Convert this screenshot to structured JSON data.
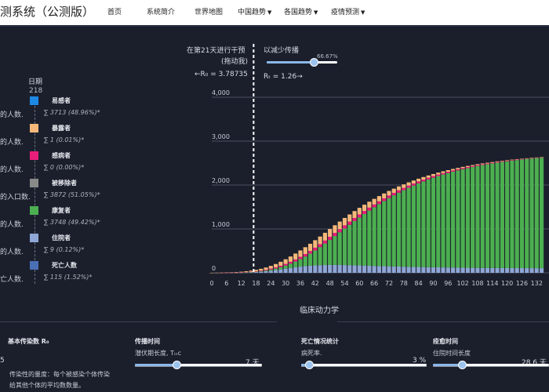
{
  "header": {
    "title": "测系统（公测版）",
    "nav": [
      {
        "label": "首页",
        "dropdown": false
      },
      {
        "label": "系统简介",
        "dropdown": false
      },
      {
        "label": "世界地图",
        "dropdown": false
      },
      {
        "label": "中国趋势",
        "dropdown": true
      },
      {
        "label": "各国趋势",
        "dropdown": true
      },
      {
        "label": "疫情预测",
        "dropdown": true
      }
    ]
  },
  "legend": {
    "date_label": "日期",
    "date_value": "218",
    "items": [
      {
        "left_text": "的人数.",
        "name": "易感者",
        "sum": "∑ 3713 (48.96%)*",
        "color": "#1e88e5"
      },
      {
        "left_text": "的人数.",
        "name": "暴露者",
        "sum": "∑ 1 (0.01%)*",
        "color": "#f5b87a"
      },
      {
        "left_text": "的人数.",
        "name": "感病者",
        "sum": "∑ 0 (0.00%)*",
        "color": "#e91e7a"
      },
      {
        "left_text": "的入口数.",
        "name": "被移除者",
        "sum": "∑ 3872 (51.05%)*",
        "color": "#8a8a8a"
      },
      {
        "left_text": "的人数.",
        "name": "康复者",
        "sum": "∑ 3748 (49.42%)*",
        "color": "#4caf50"
      },
      {
        "left_text": "的人数.",
        "name": "住院者",
        "sum": "∑ 9 (0.12%)*",
        "color": "#8fa6d6"
      },
      {
        "left_text": "亡人数.",
        "name": "死亡人数",
        "sum": "∑ 115 (1.52%)*",
        "color": "#4a6fb5"
      }
    ]
  },
  "intervention": {
    "line1": "在第21天进行干预",
    "line2": "(拖动我)",
    "r0_text": "←R₀ = 3.78735",
    "reduce_label": "以减少传播",
    "reduce_pct": "66.67%",
    "reduce_fraction": 0.6667,
    "rt_text": "Rₜ = 1.26→"
  },
  "chart_data": {
    "type": "bar",
    "stacked": true,
    "x_ticks": [
      "0",
      "6",
      "12",
      "18",
      "24",
      "30",
      "36",
      "42",
      "48",
      "54",
      "60",
      "66",
      "72",
      "78",
      "84",
      "90",
      "96",
      "102",
      "108",
      "114",
      "120",
      "126",
      "132"
    ],
    "y_ticks": [
      "0",
      "1,000",
      "2,000",
      "3,000",
      "4,000"
    ],
    "ylim": [
      0,
      4000
    ],
    "x_start": 0,
    "x_step": 2,
    "intervention_day": 17,
    "series": [
      {
        "name": "住院者",
        "color": "#8fa6d6",
        "values": [
          0,
          0,
          0,
          1,
          2,
          3,
          5,
          8,
          12,
          18,
          25,
          35,
          48,
          62,
          78,
          95,
          112,
          128,
          142,
          154,
          163,
          170,
          175,
          178,
          180,
          180,
          179,
          177,
          175,
          172,
          169,
          165,
          162,
          158,
          155,
          152,
          149,
          146,
          143,
          140,
          138,
          135,
          133,
          131,
          129,
          127,
          125,
          123,
          121,
          120,
          118,
          117,
          115,
          114,
          113,
          112,
          111,
          110,
          110,
          109,
          108,
          108,
          107,
          107,
          106,
          106,
          105,
          105
        ]
      },
      {
        "name": "康复者",
        "color": "#4caf50",
        "values": [
          0,
          0,
          0,
          0,
          0,
          1,
          2,
          3,
          5,
          8,
          12,
          18,
          26,
          37,
          52,
          72,
          98,
          130,
          170,
          218,
          275,
          340,
          412,
          490,
          572,
          658,
          745,
          833,
          920,
          1007,
          1092,
          1175,
          1256,
          1335,
          1411,
          1484,
          1554,
          1620,
          1683,
          1743,
          1800,
          1854,
          1905,
          1953,
          1998,
          2040,
          2080,
          2117,
          2152,
          2185,
          2216,
          2245,
          2272,
          2297,
          2321,
          2343,
          2363,
          2382,
          2400,
          2417,
          2433,
          2448,
          2462,
          2475,
          2487,
          2498,
          2508,
          2517
        ]
      },
      {
        "name": "感病者",
        "color": "#e91e7a",
        "values": [
          0,
          0,
          1,
          1,
          2,
          3,
          4,
          6,
          8,
          11,
          14,
          18,
          22,
          27,
          32,
          37,
          42,
          47,
          52,
          56,
          60,
          63,
          66,
          68,
          70,
          71,
          72,
          72,
          72,
          71,
          70,
          69,
          67,
          65,
          63,
          61,
          59,
          56,
          54,
          51,
          49,
          46,
          44,
          41,
          39,
          37,
          35,
          33,
          31,
          29,
          27,
          25,
          24,
          22,
          21,
          19,
          18,
          17,
          16,
          15,
          14,
          13,
          12,
          11,
          10,
          10,
          9,
          9
        ]
      },
      {
        "name": "暴露者",
        "color": "#f5b87a",
        "values": [
          1,
          2,
          3,
          5,
          7,
          10,
          14,
          19,
          25,
          32,
          40,
          50,
          62,
          75,
          90,
          105,
          120,
          134,
          146,
          156,
          164,
          170,
          174,
          176,
          176,
          175,
          172,
          168,
          163,
          157,
          150,
          143,
          135,
          127,
          119,
          111,
          103,
          95,
          88,
          81,
          74,
          68,
          62,
          57,
          52,
          47,
          43,
          39,
          35,
          32,
          29,
          26,
          24,
          22,
          20,
          18,
          16,
          15,
          13,
          12,
          11,
          10,
          9,
          8,
          7,
          7,
          6,
          6
        ]
      },
      {
        "name": "易感者",
        "color": "#f2d6a8",
        "values": [
          0,
          0,
          0,
          0,
          0,
          0,
          0,
          0,
          0,
          0,
          0,
          0,
          0,
          0,
          0,
          0,
          0,
          0,
          0,
          0,
          0,
          0,
          0,
          0,
          0,
          0,
          0,
          0,
          0,
          0,
          0,
          0,
          0,
          0,
          0,
          0,
          0,
          0,
          0,
          0,
          0,
          0,
          0,
          0,
          0,
          0,
          0,
          0,
          0,
          0,
          0,
          0,
          0,
          0,
          0,
          0,
          0,
          0,
          0,
          0,
          0,
          0,
          0,
          0,
          0,
          0,
          0,
          0
        ]
      }
    ]
  },
  "section": {
    "title": "临床动力学"
  },
  "params": {
    "r0": {
      "title": "基本传染数 R₀",
      "desc1": "传染性的量度：每个被感染个体传染",
      "desc2": "给其他个体的平均数数量。",
      "edge_value": "5"
    },
    "transmission": {
      "title": "传播时间",
      "sub": "潜伏期长度, Tᵢₙc",
      "value": "7 天",
      "fraction": 0.33
    },
    "death": {
      "title": "死亡情况统计",
      "sub": "病死率.",
      "value": "3 %",
      "fraction": 0.06
    },
    "recovery": {
      "title": "痊愈时间",
      "sub": "住院时间长度",
      "value": "28.6 天",
      "fraction": 0.25
    }
  },
  "colors": {
    "background": "#1b1f2c",
    "accent": "#8bb7e8",
    "grid": "#5c6170"
  }
}
